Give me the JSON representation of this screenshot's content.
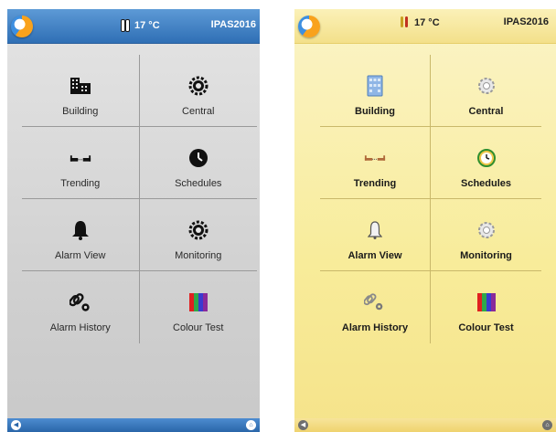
{
  "colors": {
    "left_header": "#2f6fb5",
    "left_background": "#d9d9d9",
    "right_header": "#f3e08a",
    "right_background": "#f8ec9a"
  },
  "panels": [
    {
      "theme": "blue",
      "status": {
        "temperature": "17 °C",
        "device": "IPAS2016"
      },
      "tiles": [
        {
          "label": "Building",
          "icon": "building-icon"
        },
        {
          "label": "Central",
          "icon": "gear-icon"
        },
        {
          "label": "Trending",
          "icon": "trending-icon"
        },
        {
          "label": "Schedules",
          "icon": "clock-icon"
        },
        {
          "label": "Alarm View",
          "icon": "bell-icon"
        },
        {
          "label": "Monitoring",
          "icon": "gear-icon"
        },
        {
          "label": "Alarm History",
          "icon": "chain-gear-icon"
        },
        {
          "label": "Colour Test",
          "icon": "colour-bars-icon"
        }
      ],
      "bottom": {
        "back_icon": "back-icon",
        "home_icon": "home-icon"
      }
    },
    {
      "theme": "yellow",
      "status": {
        "temperature": "17 °C",
        "device": "IPAS2016"
      },
      "tiles": [
        {
          "label": "Building",
          "icon": "building-icon"
        },
        {
          "label": "Central",
          "icon": "gear-icon"
        },
        {
          "label": "Trending",
          "icon": "trending-icon"
        },
        {
          "label": "Schedules",
          "icon": "clock-icon"
        },
        {
          "label": "Alarm View",
          "icon": "bell-icon"
        },
        {
          "label": "Monitoring",
          "icon": "gear-icon"
        },
        {
          "label": "Alarm History",
          "icon": "chain-gear-icon"
        },
        {
          "label": "Colour Test",
          "icon": "colour-bars-icon"
        }
      ],
      "bottom": {
        "back_icon": "back-icon",
        "home_icon": "home-icon"
      }
    }
  ]
}
